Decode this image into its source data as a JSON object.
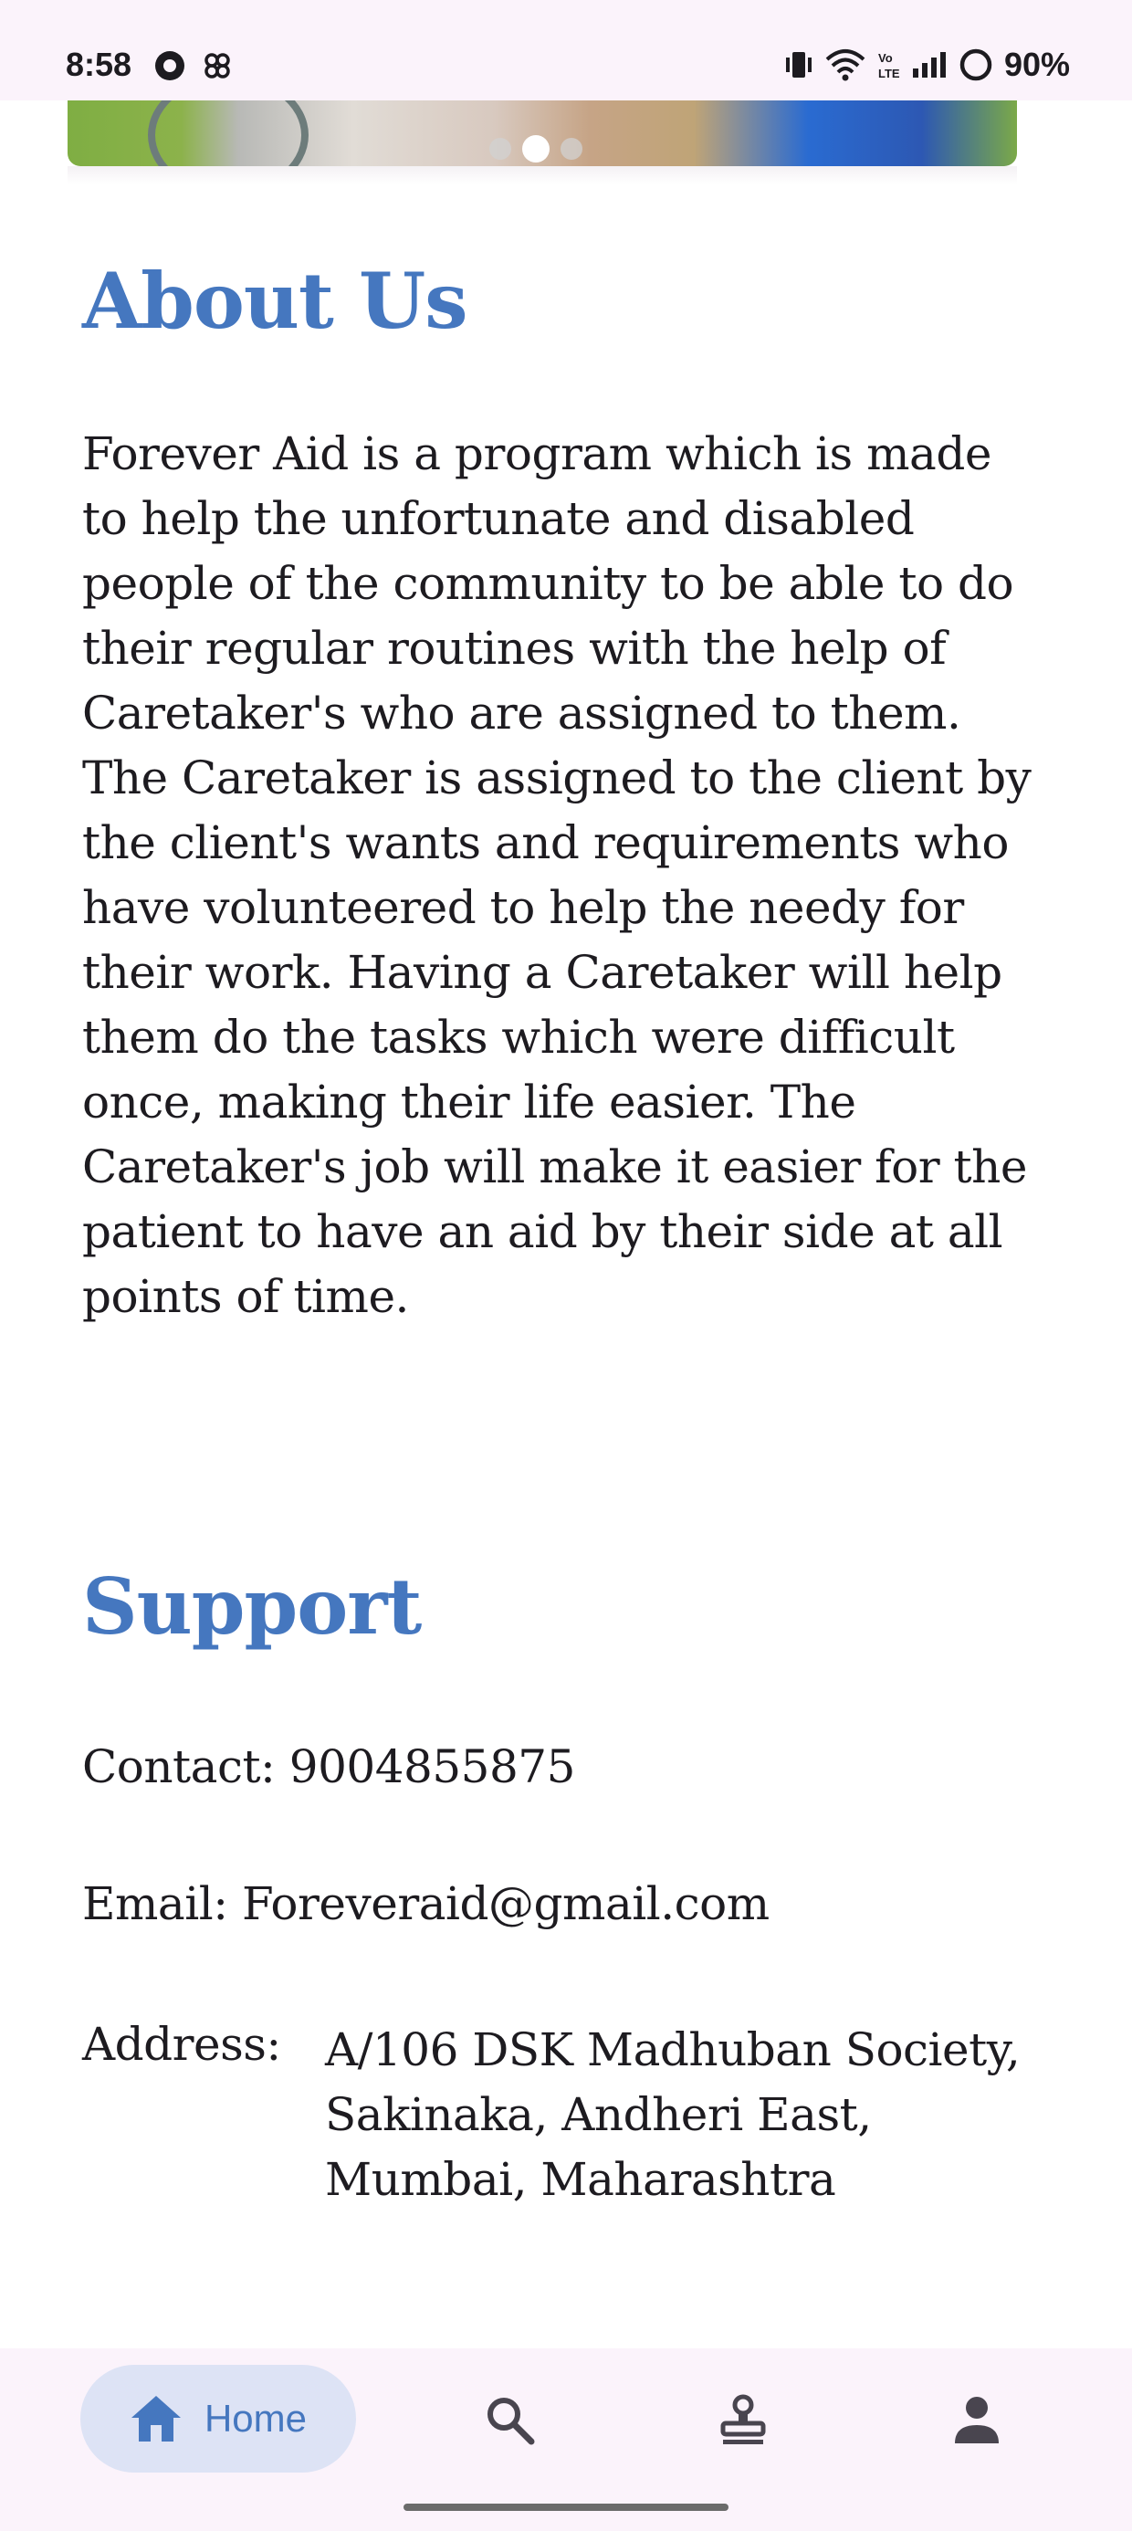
{
  "status_bar": {
    "time": "8:58",
    "battery": "90%",
    "network_label": "Vo LTE"
  },
  "carousel": {
    "slide_count": 3,
    "active_slide": 2
  },
  "about": {
    "title": "About Us",
    "body": "Forever Aid is a program which is made to help the unfortunate and disabled people of the community to be able to do their regular routines with the help of Caretaker's who are assigned to them. The Caretaker is assigned to the client by the client's wants and requirements who have volunteered to help the needy for their work. Having a Caretaker will help them do the tasks which were difficult once, making their life easier. The Caretaker's job will make it easier for the patient to have an aid by their side at all points of time."
  },
  "support": {
    "title": "Support",
    "contact": "Contact: 9004855875",
    "email": "Email: Foreveraid@gmail.com",
    "address_label": "Address:",
    "address_lines": [
      "A/106 DSK Madhuban Society,",
      "Sakinaka, Andheri East,",
      "Mumbai, Maharashtra"
    ]
  },
  "bottom_nav": {
    "items": [
      {
        "label": "Home",
        "icon": "home-icon",
        "active": true
      },
      {
        "icon": "search-icon"
      },
      {
        "icon": "stamp-icon"
      },
      {
        "icon": "person-icon"
      }
    ]
  },
  "colors": {
    "accent": "#4577bf",
    "nav_background": "#fbf3fb",
    "active_pill": "#dde3f5",
    "text": "#1d1b20"
  }
}
